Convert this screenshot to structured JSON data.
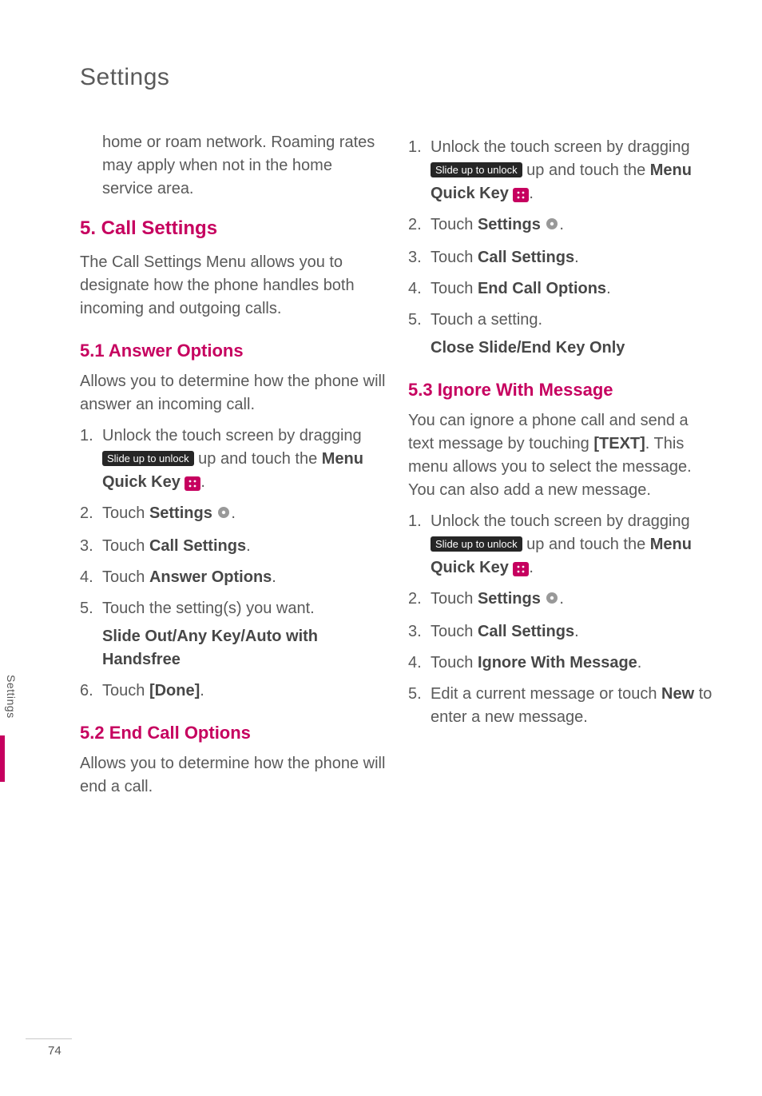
{
  "page_title": "Settings",
  "side_label": "Settings",
  "page_number": "74",
  "left": {
    "intro_cont": "home or roam network. Roaming rates may apply when not in the home service area.",
    "h5": "5. Call Settings",
    "h5_desc": "The Call Settings Menu allows you to designate how the phone handles both incoming and outgoing calls.",
    "s51": "5.1 Answer Options",
    "s51_desc": "Allows you to determine how the phone will answer an incoming call.",
    "s51_steps": {
      "1a": "Unlock the touch screen by dragging ",
      "slide": "Slide up to unlock",
      "1b": " up and touch the ",
      "1c": "Menu Quick Key",
      "2a": "Touch ",
      "2b": "Settings",
      "3a": "Touch ",
      "3b": "Call Settings",
      "4a": "Touch ",
      "4b": "Answer Options",
      "5": "Touch the setting(s) you want.",
      "5sub": "Slide Out/Any Key/Auto with Handsfree",
      "6a": "Touch ",
      "6b": "[Done]"
    },
    "s52": "5.2 End Call Options",
    "s52_desc": "Allows you to determine how the phone will end a call."
  },
  "right": {
    "steps": {
      "1a": "Unlock the touch screen by dragging ",
      "slide": "Slide up to unlock",
      "1b": " up and touch the ",
      "1c": "Menu Quick Key",
      "2a": "Touch ",
      "2b": "Settings",
      "3a": "Touch ",
      "3b": "Call Settings",
      "4a": "Touch ",
      "4b": "End Call Options",
      "5": "Touch a setting.",
      "5sub": "Close Slide/End Key Only"
    },
    "s53": "5.3 Ignore With Message",
    "s53_desc_a": "You can ignore a phone call and send a text message by touching ",
    "s53_desc_b": "[TEXT]",
    "s53_desc_c": ". This menu allows you to select the message. You can also add a new message.",
    "s53_steps": {
      "1a": "Unlock the touch screen by dragging ",
      "slide": "Slide up to unlock",
      "1b": " up and touch the ",
      "1c": "Menu Quick Key",
      "2a": "Touch ",
      "2b": "Settings",
      "3a": "Touch ",
      "3b": "Call Settings",
      "4a": "Touch ",
      "4b": "Ignore With Message",
      "5a": "Edit a current message or touch ",
      "5b": "New",
      "5c": " to enter a new message."
    }
  }
}
